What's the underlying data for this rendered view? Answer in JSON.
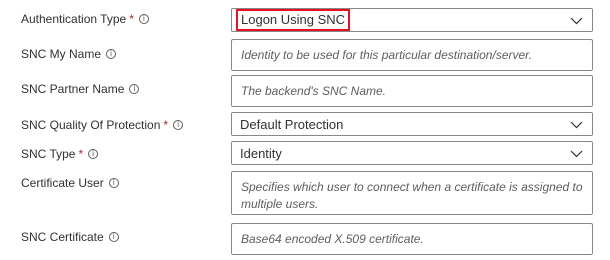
{
  "fields": {
    "auth_type": {
      "label": "Authentication Type",
      "required_mark": "*",
      "value": "Logon Using SNC"
    },
    "snc_my_name": {
      "label": "SNC My Name",
      "placeholder": "Identity to be used for this particular destination/server."
    },
    "snc_partner_name": {
      "label": "SNC Partner Name",
      "placeholder": "The backend's SNC Name."
    },
    "snc_qop": {
      "label": "SNC Quality Of Protection",
      "required_mark": "*",
      "value": "Default Protection"
    },
    "snc_type": {
      "label": "SNC Type",
      "required_mark": "*",
      "value": "Identity"
    },
    "certificate_user": {
      "label": "Certificate User",
      "placeholder": "Specifies which user to connect when a certificate is assigned to multiple users."
    },
    "snc_certificate": {
      "label": "SNC Certificate",
      "placeholder": "Base64 encoded X.509 certificate."
    }
  },
  "icons": {
    "info": "info-icon",
    "chevron": "chevron-down-icon"
  },
  "colors": {
    "highlight": "#e81123",
    "required": "#a4262c",
    "border": "#8a8886"
  }
}
